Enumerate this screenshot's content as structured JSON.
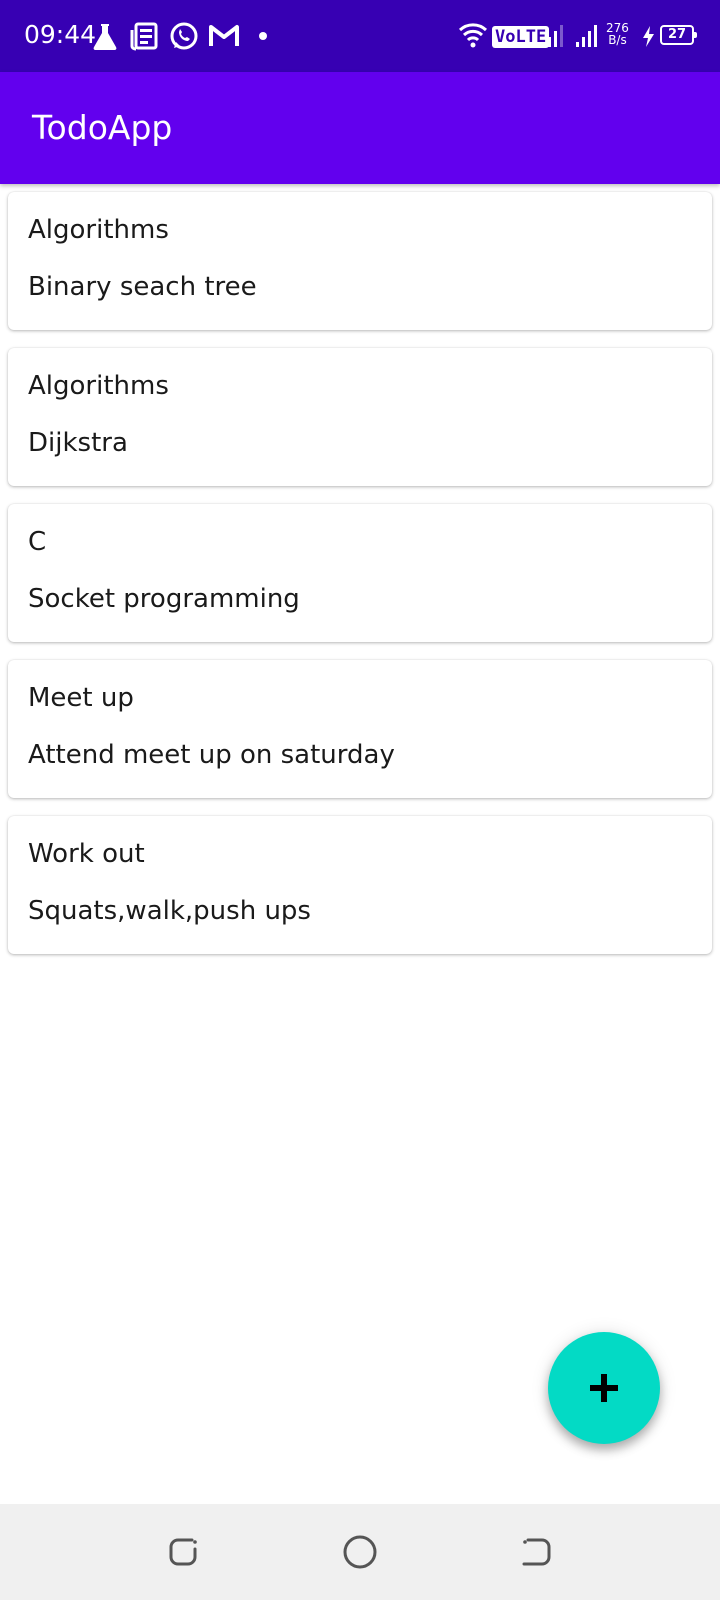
{
  "status_bar": {
    "time": "09:44",
    "network_speed_value": "276",
    "network_speed_unit": "B/s",
    "battery_level": "27",
    "volte_label": "VoLTE",
    "icons": [
      "flask-icon",
      "news-icon",
      "whatsapp-icon",
      "gmail-icon",
      "dot-icon",
      "wifi-icon",
      "volte-icon",
      "signal-icon",
      "signal-icon",
      "charging-icon",
      "battery-icon"
    ]
  },
  "app_bar": {
    "title": "TodoApp",
    "background": "#6200ee"
  },
  "todos": [
    {
      "title": "Algorithms",
      "description": "Binary seach tree"
    },
    {
      "title": "Algorithms",
      "description": "Dijkstra"
    },
    {
      "title": "C",
      "description": "Socket programming"
    },
    {
      "title": "Meet up",
      "description": "Attend meet up on saturday"
    },
    {
      "title": "Work out",
      "description": "Squats,walk,push ups"
    }
  ],
  "fab": {
    "icon": "plus-icon",
    "color": "#03dac5"
  },
  "nav_bar": {
    "icons": [
      "recents-icon",
      "home-icon",
      "back-icon"
    ]
  }
}
